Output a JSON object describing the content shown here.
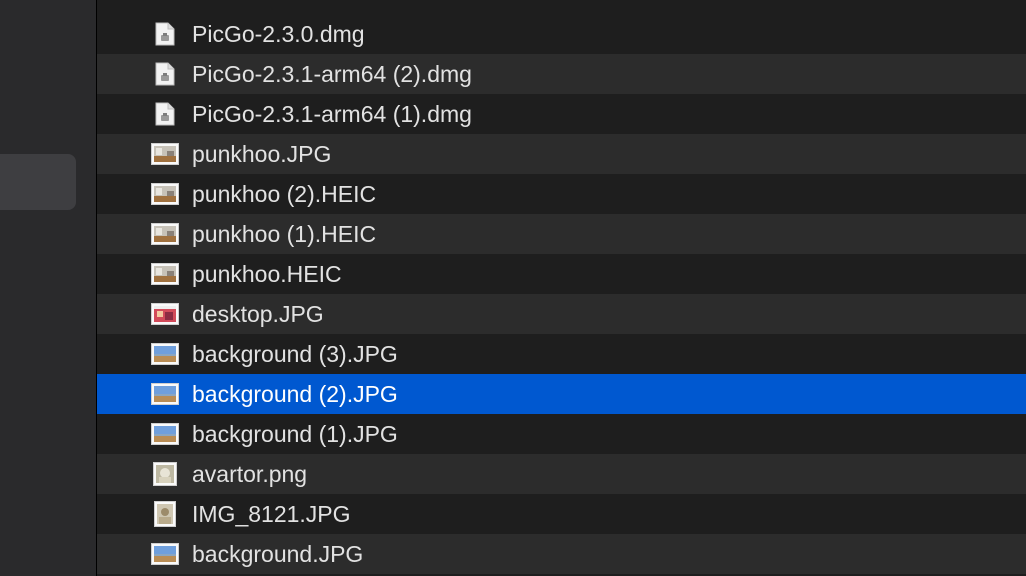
{
  "files": [
    {
      "name": "PicGo-2.3.0.dmg",
      "icon": "dmg-file-icon"
    },
    {
      "name": "PicGo-2.3.1-arm64 (2).dmg",
      "icon": "dmg-file-icon"
    },
    {
      "name": "PicGo-2.3.1-arm64 (1).dmg",
      "icon": "dmg-file-icon"
    },
    {
      "name": "punkhoo.JPG",
      "icon": "room-photo-thumbnail-icon"
    },
    {
      "name": "punkhoo (2).HEIC",
      "icon": "room-photo-thumbnail-icon"
    },
    {
      "name": "punkhoo (1).HEIC",
      "icon": "room-photo-thumbnail-icon"
    },
    {
      "name": "punkhoo.HEIC",
      "icon": "room-photo-thumbnail-icon"
    },
    {
      "name": "desktop.JPG",
      "icon": "desktop-screenshot-thumbnail-icon"
    },
    {
      "name": "background (3).JPG",
      "icon": "landscape-photo-thumbnail-icon"
    },
    {
      "name": "background (2).JPG",
      "icon": "landscape-photo-thumbnail-icon",
      "selected": true
    },
    {
      "name": "background (1).JPG",
      "icon": "landscape-photo-thumbnail-icon"
    },
    {
      "name": "avartor.png",
      "icon": "avatar-thumbnail-icon"
    },
    {
      "name": "IMG_8121.JPG",
      "icon": "portrait-photo-thumbnail-icon"
    },
    {
      "name": "background.JPG",
      "icon": "landscape-photo-thumbnail-icon"
    }
  ],
  "colors": {
    "selection": "#0058d0",
    "row_even": "#1e1e1e",
    "row_odd": "#2c2c2c",
    "sidebar": "#2a2a2c",
    "text": "#e2e2e2"
  }
}
